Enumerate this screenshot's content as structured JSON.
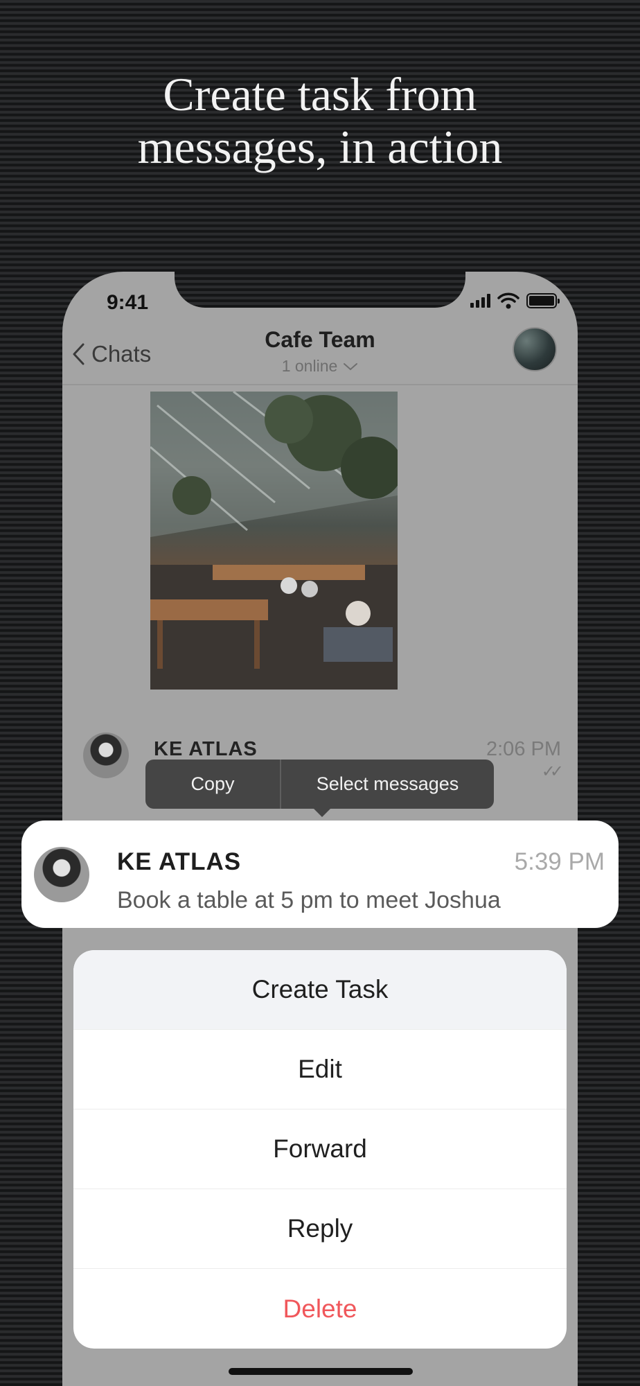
{
  "headline": {
    "line1": "Create task from",
    "line2": "messages, in action"
  },
  "status_bar": {
    "time": "9:41"
  },
  "nav": {
    "back_label": "Chats",
    "title": "Cafe Team",
    "subtitle": "1 online"
  },
  "chat_message": {
    "sender": "KE ATLAS",
    "time": "2:06 PM"
  },
  "context_menu": {
    "copy": "Copy",
    "select": "Select messages"
  },
  "selected_message": {
    "sender": "KE ATLAS",
    "time": "5:39 PM",
    "text": "Book a table at 5 pm to meet Joshua"
  },
  "action_sheet": {
    "items": [
      {
        "label": "Create Task"
      },
      {
        "label": "Edit"
      },
      {
        "label": "Forward"
      },
      {
        "label": "Reply"
      },
      {
        "label": "Delete"
      }
    ]
  },
  "colors": {
    "danger": "#f0575b",
    "dim_overlay": "#a4a4a4",
    "menu_dark": "#454545"
  }
}
